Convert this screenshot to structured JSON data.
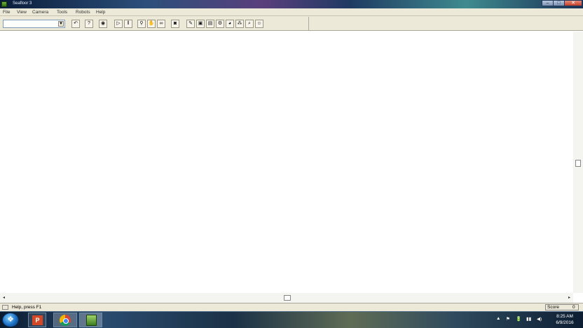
{
  "window": {
    "title": "Seafloor 3"
  },
  "menu": [
    "File",
    "View",
    "Camera",
    "Tools",
    "Robots",
    "Help"
  ],
  "toolbar": {
    "combo_value": "",
    "buttons": [
      {
        "name": "undo-icon",
        "glyph": "↶"
      },
      {
        "name": "help-icon",
        "glyph": "?"
      },
      {
        "name": "eye-icon",
        "glyph": "◉"
      },
      {
        "name": "play-icon",
        "glyph": "▷"
      },
      {
        "name": "pause-icon",
        "glyph": "‖"
      },
      {
        "name": "tool-a-icon",
        "glyph": "⚲"
      },
      {
        "name": "tool-b-icon",
        "glyph": "✋"
      },
      {
        "name": "tool-c-icon",
        "glyph": "∞"
      },
      {
        "name": "camera-icon",
        "glyph": "◙"
      },
      {
        "name": "pen-icon",
        "glyph": "✎"
      },
      {
        "name": "view-a-icon",
        "glyph": "▣"
      },
      {
        "name": "view-b-icon",
        "glyph": "▤"
      },
      {
        "name": "robot-icon",
        "glyph": "⚙"
      },
      {
        "name": "globe-icon",
        "glyph": "◕"
      },
      {
        "name": "network-icon",
        "glyph": "⁂"
      },
      {
        "name": "zoom-icon",
        "glyph": "⌕"
      },
      {
        "name": "person-icon",
        "glyph": "☺"
      }
    ]
  },
  "status": {
    "hint": "Help, press F1",
    "score_label": "Score",
    "score_value": "0"
  },
  "taskbar": {
    "start_glyph": "❖",
    "pp_label": "P",
    "time": "8:25 AM",
    "date": "6/9/2016",
    "tray_icons": [
      "▲",
      "⚑",
      "🔋",
      "▮▮",
      "◀)"
    ]
  }
}
